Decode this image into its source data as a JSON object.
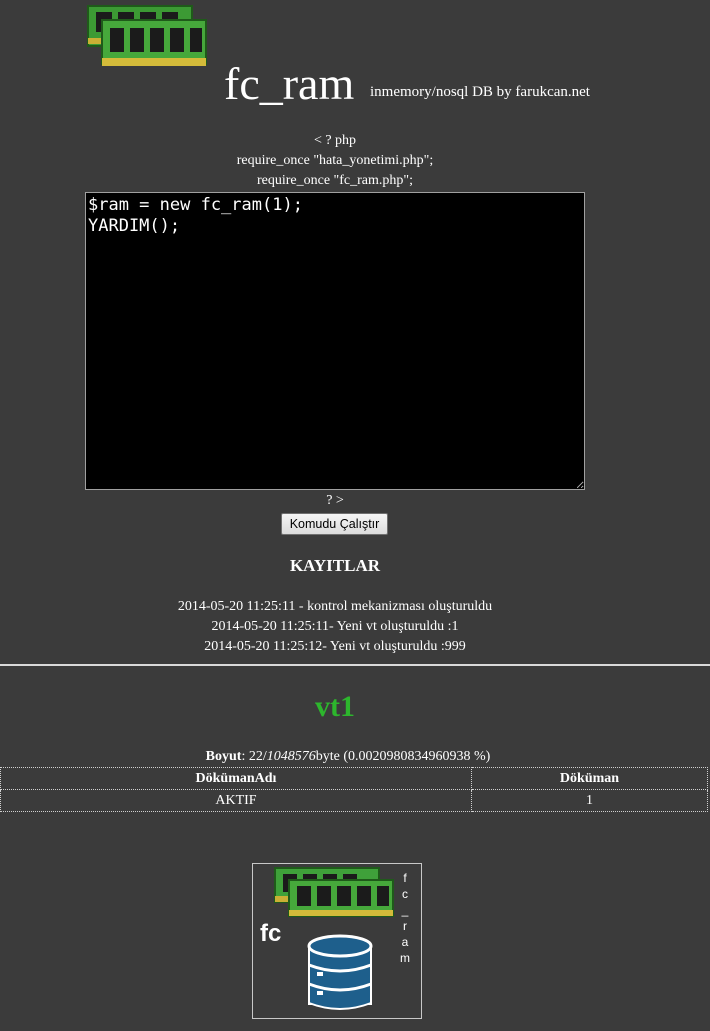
{
  "header": {
    "title": "fc_ram",
    "subtitle": "inmemory/nosql DB by farukcan.net",
    "logo_icon": "ram-modules-icon"
  },
  "php": {
    "open_tag": "< ? php",
    "require_1": "require_once \"hata_yonetimi.php\";",
    "require_2": "require_once \"fc_ram.php\";",
    "code": "$ram = new fc_ram(1);\nYARDIM();",
    "close_tag": "? >"
  },
  "run_button_label": "Komudu Çalıştır",
  "logs": {
    "title": "KAYITLAR",
    "entries": [
      "2014-05-20 11:25:11 - kontrol mekanizması oluşturuldu",
      "2014-05-20 11:25:11- Yeni vt oluşturuldu :1",
      "2014-05-20 11:25:12- Yeni vt oluşturuldu :999"
    ]
  },
  "database": {
    "name": "vt1",
    "size_label": "Boyut",
    "size_used": "22",
    "size_total": "1048576",
    "size_unit": "byte",
    "size_percent": "(0.0020980834960938 %)",
    "table": {
      "columns": [
        "DökümanAdı",
        "Döküman"
      ],
      "rows": [
        [
          "AKTIF",
          "1"
        ]
      ]
    }
  },
  "footer": {
    "logo_text": "fc",
    "logo_vertical_text": [
      "f",
      "c",
      "_",
      "r",
      "a",
      "m"
    ],
    "colors": {
      "ram_green": "#3fa13a",
      "db_blue": "#1e5f8c"
    }
  },
  "colors": {
    "background": "#3b3b3b",
    "db_name": "#2db62d"
  }
}
